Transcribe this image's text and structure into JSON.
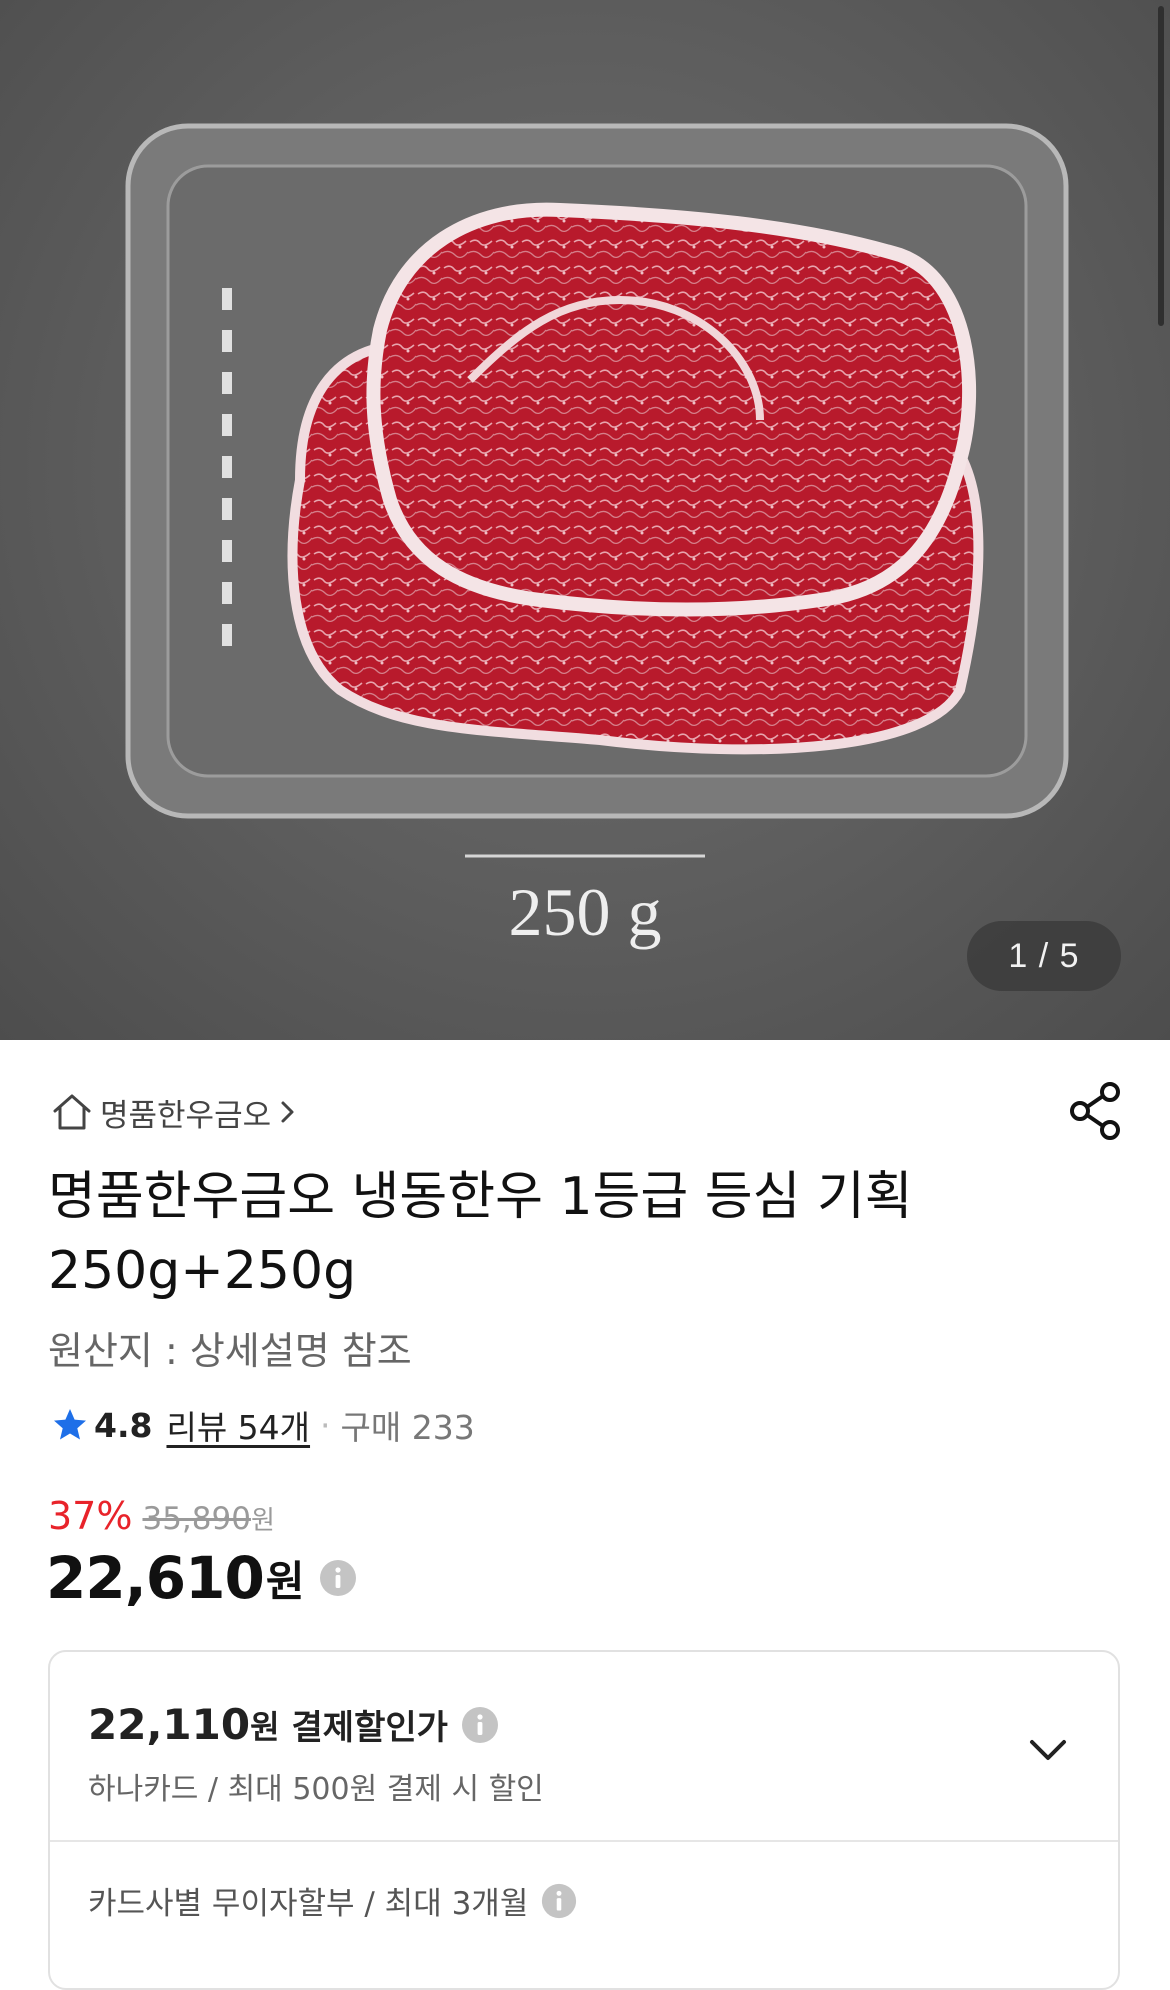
{
  "gallery": {
    "image_label": "250 g",
    "counter": "1 / 5"
  },
  "store": {
    "name": "명품한우금오",
    "icons": {
      "home": "home-icon",
      "chevron": "chevron-right-icon",
      "share": "share-icon"
    }
  },
  "product": {
    "title": "명품한우금오 냉동한우 1등급 등심 기획 250g+250g",
    "origin": "원산지 : 상세설명 참조"
  },
  "rating": {
    "score": "4.8",
    "reviews": "리뷰 54개",
    "separator": "·",
    "purchases": "구매 233",
    "star_color": "#1e6fe8"
  },
  "pricing": {
    "discount_percent": "37%",
    "original_price": "35,890",
    "original_unit": "원",
    "price": "22,610",
    "price_unit": "원",
    "discount_color": "#e8232a"
  },
  "card_benefit": {
    "amount": "22,110",
    "amount_unit": "원",
    "label": "결제할인가",
    "description": "하나카드 / 최대 500원 결제 시 할인",
    "installment": "카드사별 무이자할부 / 최대 3개월"
  }
}
